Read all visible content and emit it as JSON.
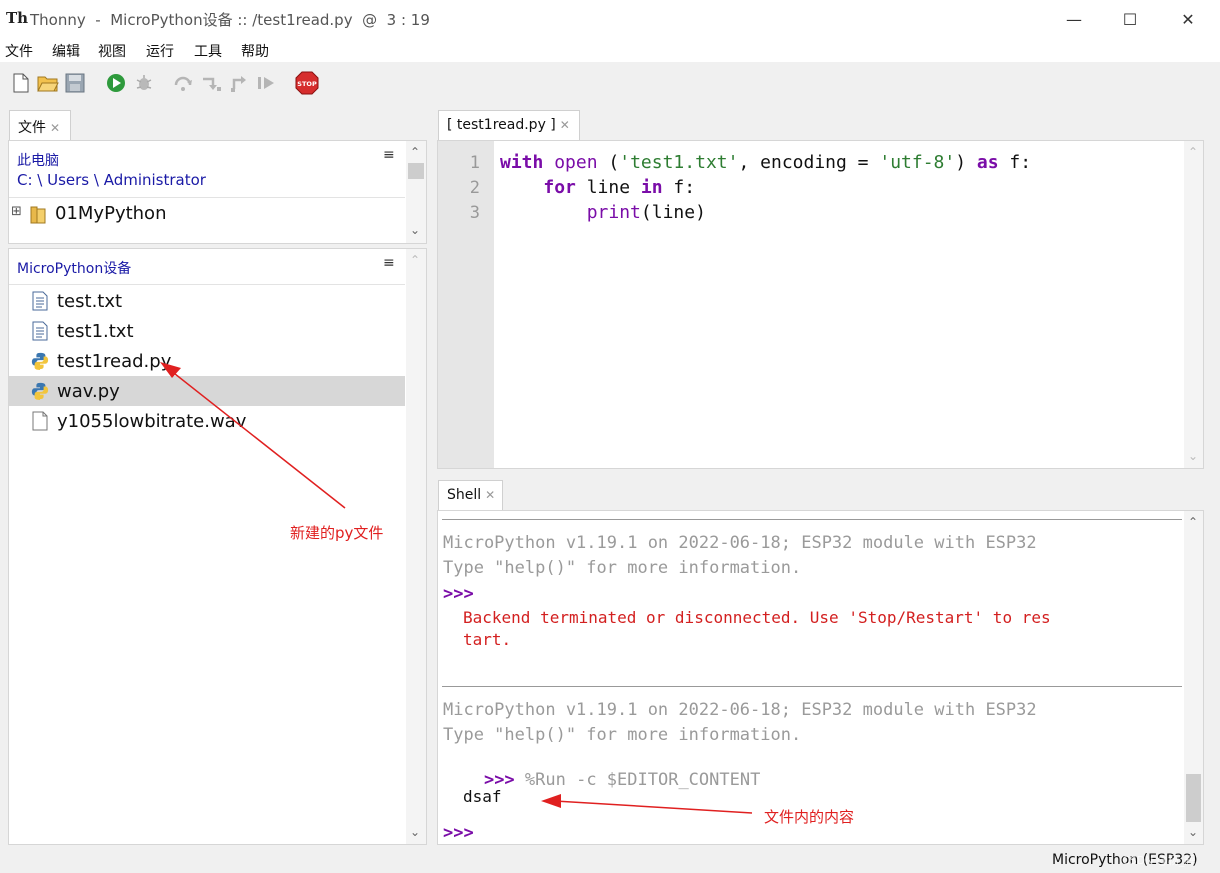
{
  "window": {
    "title": "Thonny  -  MicroPython设备 :: /test1read.py  @  3 : 19",
    "logo_text": "Th",
    "min_label": "—",
    "max_label": "☐",
    "close_label": "✕"
  },
  "menu": [
    "文件",
    "编辑",
    "视图",
    "运行",
    "工具",
    "帮助"
  ],
  "toolbar": {
    "icons": [
      "new-file-icon",
      "open-file-icon",
      "save-icon",
      "run-icon",
      "debug-icon",
      "step-over-icon",
      "step-into-icon",
      "step-out-icon",
      "resume-icon",
      "stop-icon"
    ],
    "stop_label": "STOP"
  },
  "files_tab": {
    "label": "文件",
    "close": "✕"
  },
  "computer": {
    "header": "此电脑",
    "path": "C: \\ Users \\ Administrator",
    "menu_glyph": "≡",
    "items": [
      {
        "name": "01MyPython",
        "type": "folder",
        "expander": "⊞"
      }
    ]
  },
  "device": {
    "header": "MicroPython设备",
    "menu_glyph": "≡",
    "items": [
      {
        "name": "test.txt",
        "type": "text"
      },
      {
        "name": "test1.txt",
        "type": "text"
      },
      {
        "name": "test1read.py",
        "type": "python"
      },
      {
        "name": "wav.py",
        "type": "python",
        "selected": true
      },
      {
        "name": "y1055lowbitrate.wav",
        "type": "file"
      }
    ]
  },
  "editor": {
    "tab_label": "[ test1read.py ]",
    "tab_close": "✕",
    "line_numbers": [
      "1",
      "2",
      "3"
    ],
    "lines": [
      [
        {
          "t": "with",
          "c": "kw"
        },
        {
          "t": " "
        },
        {
          "t": "open",
          "c": "bi"
        },
        {
          "t": " ("
        },
        {
          "t": "'test1.txt'",
          "c": "str"
        },
        {
          "t": ", encoding = "
        },
        {
          "t": "'utf-8'",
          "c": "str"
        },
        {
          "t": ") "
        },
        {
          "t": "as",
          "c": "kw"
        },
        {
          "t": " f:"
        }
      ],
      [
        {
          "t": "    "
        },
        {
          "t": "for",
          "c": "kw"
        },
        {
          "t": " line "
        },
        {
          "t": "in",
          "c": "kw"
        },
        {
          "t": " f:"
        }
      ],
      [
        {
          "t": "        "
        },
        {
          "t": "print",
          "c": "bi"
        },
        {
          "t": "(line)"
        }
      ]
    ]
  },
  "shell": {
    "tab_label": "Shell",
    "tab_close": "✕",
    "banner1": "MicroPython v1.19.1 on 2022-06-18; ESP32 module with ESP32",
    "banner2": "Type \"help()\" for more information.",
    "prompt": ">>>",
    "error_line1": "Backend terminated or disconnected. Use 'Stop/Restart' to res",
    "error_line2": "tart.",
    "banner3": "MicroPython v1.19.1 on 2022-06-18; ESP32 module with ESP32",
    "banner4": "Type \"help()\" for more information.",
    "run_command": "%Run -c $EDITOR_CONTENT",
    "output": "dsaf",
    "final_prompt": ">>>"
  },
  "annotations": {
    "new_file": "新建的py文件",
    "file_content": "文件内的内容",
    "color": "#e02020"
  },
  "status": {
    "interpreter": "MicroPython (ESP32)",
    "watermark": "CSDN @杨_辉"
  }
}
